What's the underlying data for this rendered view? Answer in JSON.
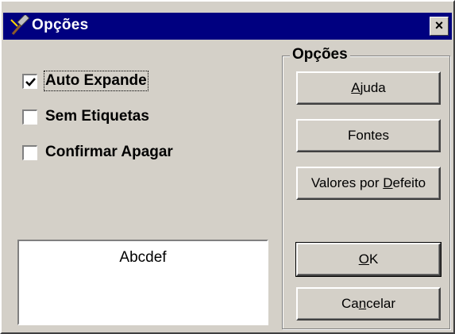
{
  "window": {
    "title": "Opções",
    "close_symbol": "×",
    "title_icon": "hammer-icon"
  },
  "options": {
    "checkboxes": [
      {
        "label": "Auto Expande",
        "checked": true
      },
      {
        "label": "Sem Etiquetas",
        "checked": false
      },
      {
        "label": "Confirmar Apagar",
        "checked": false
      }
    ]
  },
  "preview": {
    "text": "Abcdef"
  },
  "group": {
    "title": "Opções",
    "buttons": {
      "help": {
        "pre": "",
        "ul": "A",
        "post": "juda"
      },
      "fonts": {
        "pre": "Fontes",
        "ul": "",
        "post": ""
      },
      "defaults": {
        "pre": "Valores por ",
        "ul": "D",
        "post": "efeito"
      },
      "ok": {
        "pre": "",
        "ul": "O",
        "post": "K"
      },
      "cancel": {
        "pre": "Ca",
        "ul": "n",
        "post": "celar"
      }
    }
  },
  "colors": {
    "titlebar": "#000080",
    "face": "#d4d0c8"
  }
}
